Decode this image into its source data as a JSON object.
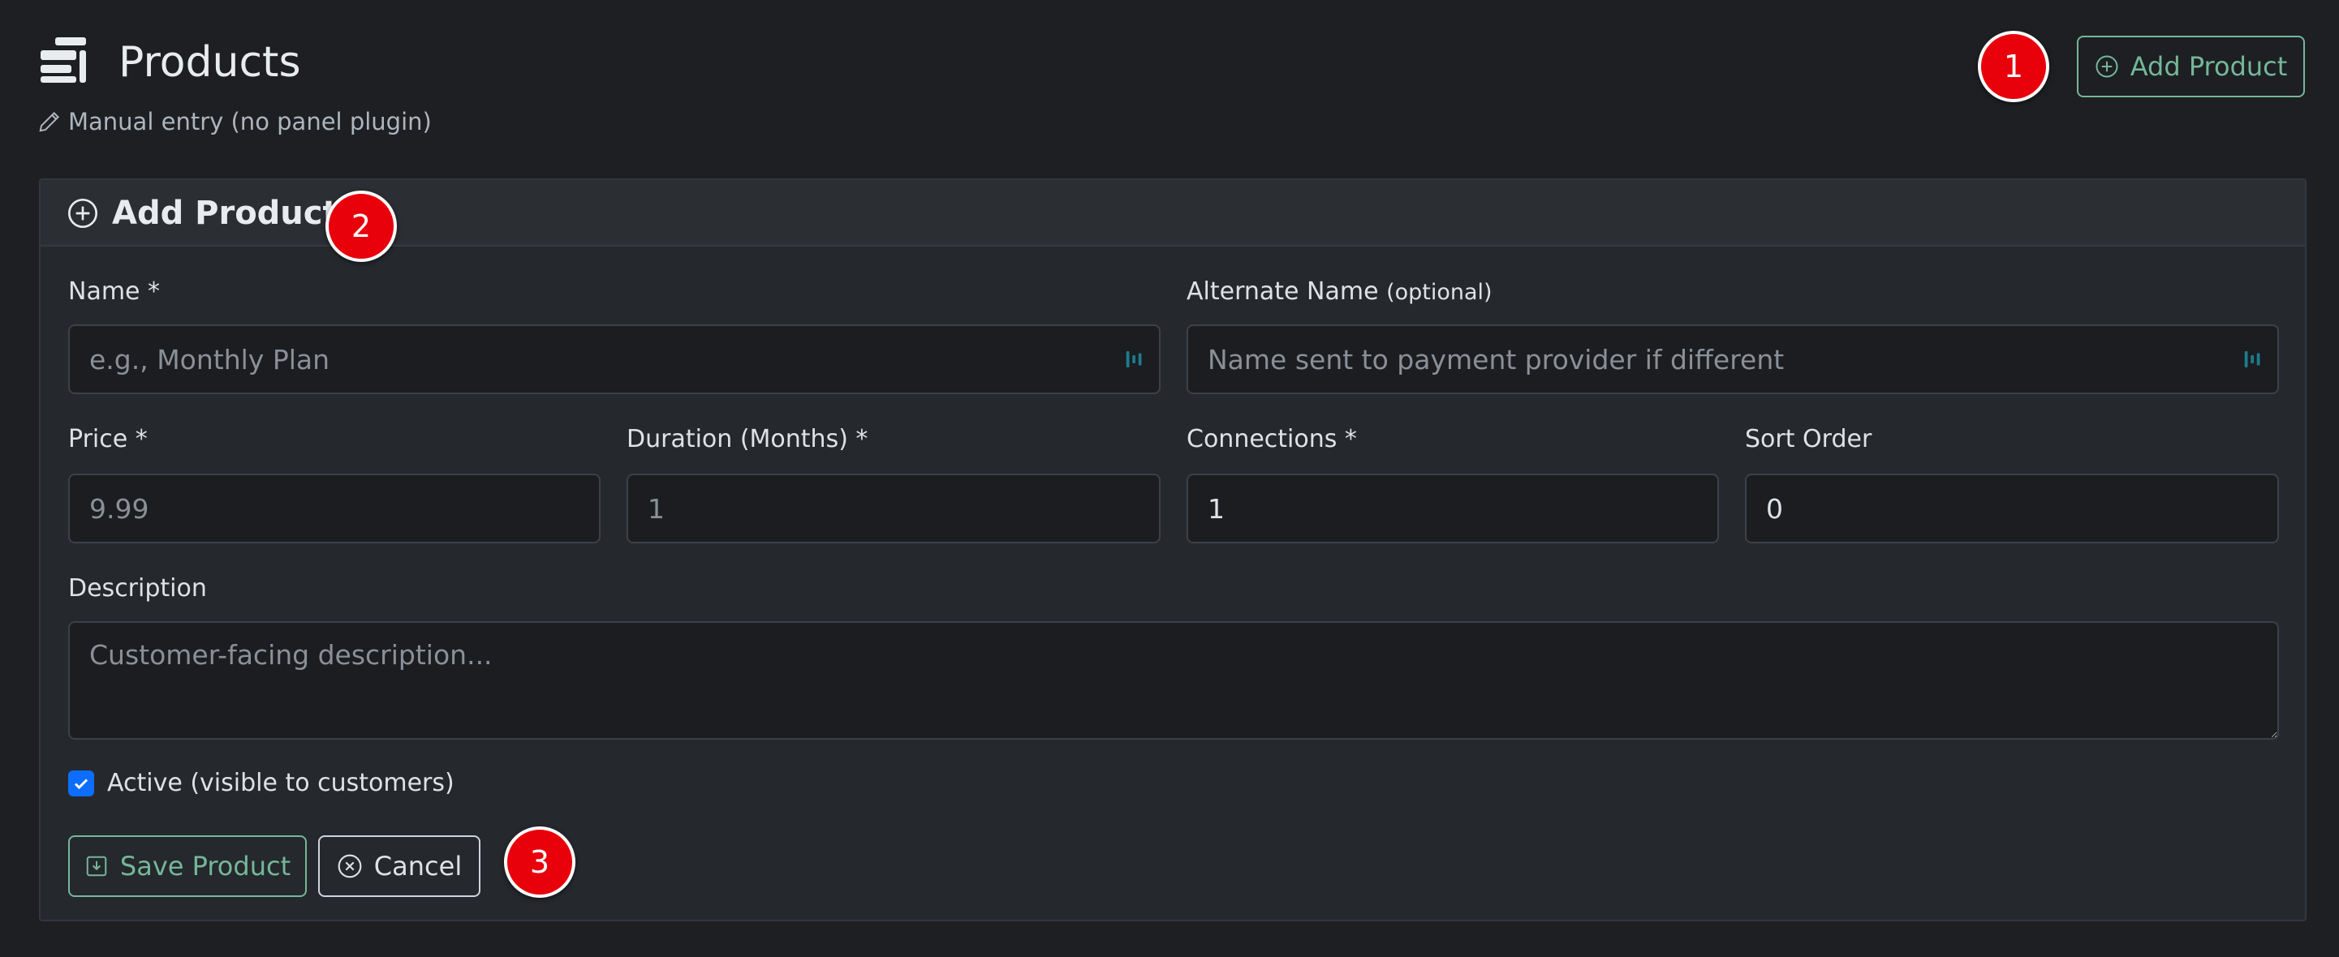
{
  "header": {
    "title": "Products",
    "subtitle": "Manual entry (no panel plugin)",
    "add_button_label": "Add Product"
  },
  "markers": [
    "1",
    "2",
    "3"
  ],
  "card": {
    "title": "Add Product"
  },
  "form": {
    "name": {
      "label": "Name *",
      "value": "",
      "placeholder": "e.g., Monthly Plan"
    },
    "alt_name": {
      "label": "Alternate Name",
      "label_suffix": "(optional)",
      "value": "",
      "placeholder": "Name sent to payment provider if different"
    },
    "price": {
      "label": "Price *",
      "value": "",
      "placeholder": "9.99"
    },
    "duration": {
      "label": "Duration (Months) *",
      "value": "",
      "placeholder": "1"
    },
    "connections": {
      "label": "Connections *",
      "value": "1"
    },
    "sort_order": {
      "label": "Sort Order",
      "value": "0"
    },
    "description": {
      "label": "Description",
      "value": "",
      "placeholder": "Customer-facing description..."
    },
    "active": {
      "label": "Active (visible to customers)",
      "checked": true
    }
  },
  "actions": {
    "save_label": "Save Product",
    "cancel_label": "Cancel"
  },
  "colors": {
    "background": "#1d1f23",
    "card": "#25282d",
    "accent_success": "#75b798",
    "checkbox": "#0d6efd",
    "marker": "#e8000b"
  },
  "icons": {
    "title": "layers-icon",
    "subtitle": "pencil-icon",
    "add": "plus-circle-icon",
    "save": "save-download-icon",
    "cancel": "x-circle-icon",
    "password_manager": "password-manager-icon"
  }
}
